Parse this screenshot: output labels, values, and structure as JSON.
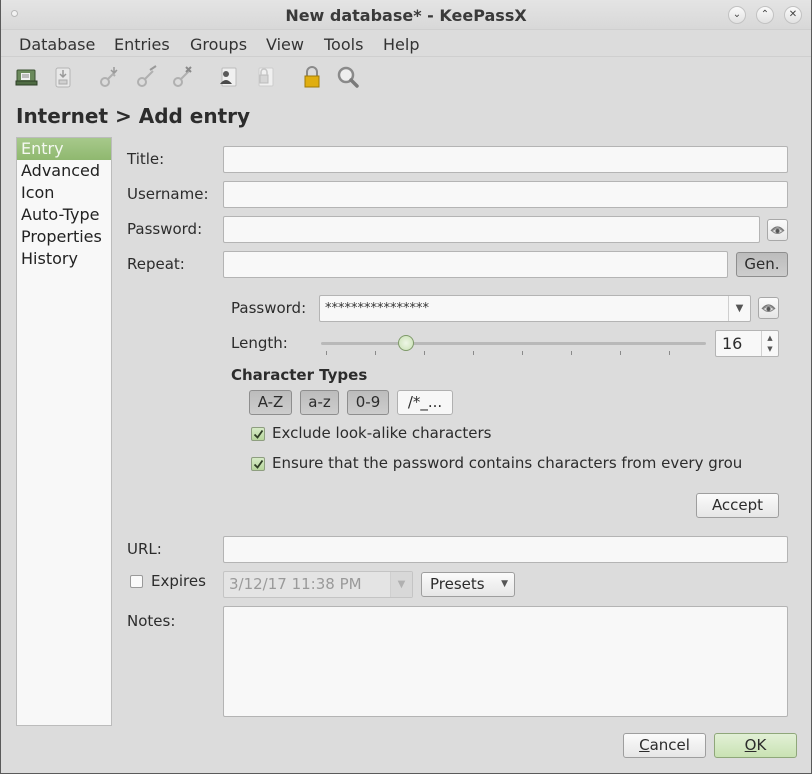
{
  "window": {
    "title": "New database* - KeePassX",
    "controls": [
      "minimize",
      "maximize",
      "close"
    ]
  },
  "menu": [
    "Database",
    "Entries",
    "Groups",
    "View",
    "Tools",
    "Help"
  ],
  "toolbar": [
    {
      "name": "open-database-icon"
    },
    {
      "name": "save-database-icon"
    },
    {
      "name": "add-entry-icon"
    },
    {
      "name": "edit-entry-icon"
    },
    {
      "name": "delete-entry-icon"
    },
    {
      "name": "copy-username-icon"
    },
    {
      "name": "copy-password-icon"
    },
    {
      "name": "lock-database-icon"
    },
    {
      "name": "search-icon"
    }
  ],
  "heading": "Internet > Add entry",
  "sidebar": {
    "items": [
      "Entry",
      "Advanced",
      "Icon",
      "Auto-Type",
      "Properties",
      "History"
    ],
    "selected": "Entry"
  },
  "form": {
    "title_label": "Title:",
    "title_value": "",
    "username_label": "Username:",
    "username_value": "",
    "password_label": "Password:",
    "password_value": "",
    "repeat_label": "Repeat:",
    "repeat_value": "",
    "gen_button": "Gen.",
    "url_label": "URL:",
    "url_value": "",
    "expires_label": "Expires",
    "expires_checked": false,
    "expires_date": "3/12/17 11:38 PM",
    "presets_label": "Presets",
    "notes_label": "Notes:",
    "notes_value": ""
  },
  "generator": {
    "password_label": "Password:",
    "password_value": "****************",
    "length_label": "Length:",
    "length_value": "16",
    "section_title": "Character Types",
    "char_types": [
      {
        "label": "A-Z",
        "active": true
      },
      {
        "label": "a-z",
        "active": true
      },
      {
        "label": "0-9",
        "active": true
      },
      {
        "label": "/*_...",
        "active": false
      }
    ],
    "exclude_lookalike_label": "Exclude look-alike characters",
    "exclude_lookalike_checked": true,
    "every_group_label": "Ensure that the password contains characters from every grou",
    "every_group_checked": true,
    "accept_button": "Accept"
  },
  "dialog": {
    "cancel_button": "Cancel",
    "cancel_mnemonic": "C",
    "ok_button": "OK",
    "ok_mnemonic": "O"
  },
  "colors": {
    "accent_green": "#9cc17d",
    "background": "#dcdcdc",
    "lock_yellow": "#e0ae10"
  }
}
